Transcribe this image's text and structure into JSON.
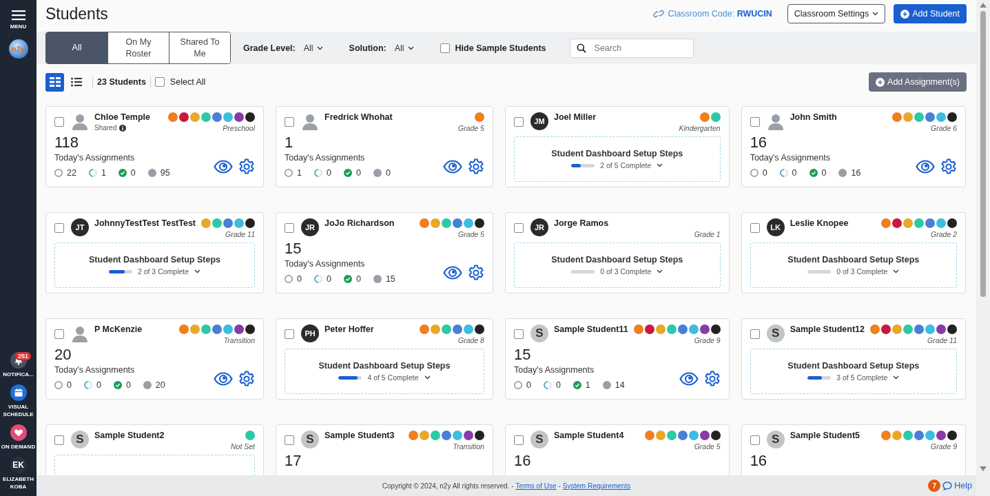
{
  "sidebar": {
    "menu_label": "MENU",
    "logo_text": "n2y",
    "items": [
      {
        "kind": "notifications",
        "label": "NOTIFICA...",
        "badge": "251"
      },
      {
        "kind": "schedule",
        "label": "VISUAL SCHEDULE"
      },
      {
        "kind": "demand",
        "label": "ON DEMAND"
      },
      {
        "kind": "user",
        "initials": "EK",
        "label": "ELIZABETH KOBA"
      }
    ]
  },
  "header": {
    "title": "Students",
    "classroom_code": "Classroom Code: **RWUCIN**",
    "settings_button": "Classroom Settings",
    "add_button": "Add Student"
  },
  "filters": {
    "tabs": [
      {
        "label": "All",
        "selected": true
      },
      {
        "label": "On My Roster",
        "selected": false
      },
      {
        "label": "Shared To Me",
        "selected": false
      }
    ],
    "dropdowns": [
      {
        "label": "Grade Level:",
        "value": "All"
      },
      {
        "label": "Solution:",
        "value": "All"
      }
    ],
    "hide_sample": {
      "label": "Hide Sample Students",
      "checked": false
    },
    "search": {
      "placeholder": "Search"
    }
  },
  "toolbar": {
    "views": [
      {
        "kind": "grid",
        "selected": true
      },
      {
        "kind": "list",
        "selected": false
      }
    ],
    "count": "23 Students",
    "select_all": {
      "label": "Select All",
      "checked": false
    },
    "add_assignments": "Add Assignment(s)"
  },
  "cards": [
    {
      "name": "Chloe Temple",
      "checked": false,
      "avatar": {
        "kind": "image"
      },
      "shared": "Shared",
      "grade": "Preschool",
      "solutions": [
        {
          "color": "#f07f1e"
        },
        {
          "color": "#c8193c"
        },
        {
          "color": "#e8a928"
        },
        {
          "color": "#2cc9a8"
        },
        {
          "color": "#4a7fd6"
        },
        {
          "color": "#3dbde0"
        },
        {
          "color": "#8a3aa8"
        },
        {
          "color": "#222222"
        }
      ],
      "kind": "assignments",
      "total": "118",
      "label": "Today's Assignments",
      "stats": [
        {
          "kind": "not_started",
          "count": "22"
        },
        {
          "kind": "in_progress",
          "count": "1"
        },
        {
          "kind": "complete",
          "count": "0"
        },
        {
          "kind": "other",
          "count": "95"
        }
      ]
    },
    {
      "name": "Fredrick Whohat",
      "checked": false,
      "avatar": {
        "kind": "image"
      },
      "grade": "Grade 5",
      "solutions": [
        {
          "color": "#f07f1e"
        }
      ],
      "kind": "assignments",
      "total": "1",
      "label": "Today's Assignments",
      "stats": [
        {
          "kind": "not_started",
          "count": "1"
        },
        {
          "kind": "in_progress",
          "count": "0"
        },
        {
          "kind": "complete",
          "count": "0"
        },
        {
          "kind": "other",
          "count": "0"
        }
      ]
    },
    {
      "name": "Joel Miller",
      "checked": false,
      "avatar": {
        "kind": "initials",
        "text": "JM"
      },
      "grade": "Kindergarten",
      "solutions": [
        {
          "color": "#f07f1e"
        },
        {
          "color": "#2cc9a8"
        }
      ],
      "kind": "setup",
      "setup_title": "Student Dashboard Setup Steps",
      "progress": "2 of 5 Complete",
      "level": 0.4
    },
    {
      "name": "John Smith",
      "checked": false,
      "avatar": {
        "kind": "image"
      },
      "grade": "Grade 6",
      "solutions": [
        {
          "color": "#f07f1e"
        },
        {
          "color": "#e8a928"
        },
        {
          "color": "#2cc9a8"
        },
        {
          "color": "#4a7fd6"
        },
        {
          "color": "#3dbde0"
        },
        {
          "color": "#222222"
        }
      ],
      "kind": "assignments",
      "total": "16",
      "label": "Today's Assignments",
      "stats": [
        {
          "kind": "not_started",
          "count": "0"
        },
        {
          "kind": "in_progress",
          "count": "0"
        },
        {
          "kind": "complete",
          "count": "0"
        },
        {
          "kind": "other",
          "count": "16"
        }
      ]
    },
    {
      "name": "JohnnyTestTest TestTest",
      "checked": false,
      "avatar": {
        "kind": "initials",
        "text": "JT"
      },
      "grade": "Grade 11",
      "solutions": [
        {
          "color": "#e8a928"
        },
        {
          "color": "#2cc9a8"
        },
        {
          "color": "#4a7fd6"
        },
        {
          "color": "#3dbde0"
        },
        {
          "color": "#222222"
        }
      ],
      "kind": "setup",
      "setup_title": "Student Dashboard Setup Steps",
      "progress": "2 of 3 Complete",
      "level": 0.67
    },
    {
      "name": "JoJo Richardson",
      "checked": false,
      "avatar": {
        "kind": "initials",
        "text": "JR"
      },
      "grade": "Grade 5",
      "solutions": [
        {
          "color": "#f07f1e"
        },
        {
          "color": "#e8a928"
        },
        {
          "color": "#2cc9a8"
        },
        {
          "color": "#4a7fd6"
        },
        {
          "color": "#3dbde0"
        },
        {
          "color": "#222222"
        }
      ],
      "kind": "assignments",
      "total": "15",
      "label": "Today's Assignments",
      "stats": [
        {
          "kind": "not_started",
          "count": "0"
        },
        {
          "kind": "in_progress",
          "count": "0"
        },
        {
          "kind": "complete",
          "count": "0"
        },
        {
          "kind": "other",
          "count": "15"
        }
      ]
    },
    {
      "name": "Jorge Ramos",
      "checked": false,
      "avatar": {
        "kind": "initials",
        "text": "JR"
      },
      "grade": "Grade 1",
      "kind": "setup",
      "setup_title": "Student Dashboard Setup Steps",
      "progress": "0 of 3 Complete",
      "level": 0
    },
    {
      "name": "Leslie Knopee",
      "checked": false,
      "avatar": {
        "kind": "initials",
        "text": "LK"
      },
      "grade": "Grade 2",
      "solutions": [
        {
          "color": "#f07f1e"
        },
        {
          "color": "#c8193c"
        },
        {
          "color": "#e8a928"
        },
        {
          "color": "#2cc9a8"
        },
        {
          "color": "#4a7fd6"
        },
        {
          "color": "#3dbde0"
        },
        {
          "color": "#222222"
        }
      ],
      "kind": "setup",
      "setup_title": "Student Dashboard Setup Steps",
      "progress": "0 of 3 Complete",
      "level": 0
    },
    {
      "name": "P McKenzie",
      "checked": false,
      "avatar": {
        "kind": "image"
      },
      "grade": "Transition",
      "solutions": [
        {
          "color": "#f07f1e"
        },
        {
          "color": "#e8a928"
        },
        {
          "color": "#2cc9a8"
        },
        {
          "color": "#4a7fd6"
        },
        {
          "color": "#3dbde0"
        },
        {
          "color": "#8a3aa8"
        },
        {
          "color": "#222222"
        }
      ],
      "kind": "assignments",
      "total": "20",
      "label": "Today's Assignments",
      "stats": [
        {
          "kind": "not_started",
          "count": "0"
        },
        {
          "kind": "in_progress",
          "count": "0"
        },
        {
          "kind": "complete",
          "count": "0"
        },
        {
          "kind": "other",
          "count": "20"
        }
      ]
    },
    {
      "name": "Peter Hoffer",
      "checked": false,
      "avatar": {
        "kind": "initials",
        "text": "PH"
      },
      "grade": "Grade 8",
      "solutions": [
        {
          "color": "#f07f1e"
        },
        {
          "color": "#e8a928"
        },
        {
          "color": "#2cc9a8"
        },
        {
          "color": "#4a7fd6"
        },
        {
          "color": "#3dbde0"
        },
        {
          "color": "#222222"
        }
      ],
      "kind": "setup",
      "setup_title": "Student Dashboard Setup Steps",
      "progress": "4 of 5 Complete",
      "level": 0.8
    },
    {
      "name": "Sample Student11",
      "checked": false,
      "avatar": {
        "kind": "sample",
        "text": "S"
      },
      "grade": "Grade 9",
      "solutions": [
        {
          "color": "#f07f1e"
        },
        {
          "color": "#c8193c"
        },
        {
          "color": "#e8a928"
        },
        {
          "color": "#2cc9a8"
        },
        {
          "color": "#4a7fd6"
        },
        {
          "color": "#3dbde0"
        },
        {
          "color": "#8a3aa8"
        },
        {
          "color": "#222222"
        }
      ],
      "kind": "assignments",
      "total": "15",
      "label": "Today's Assignments",
      "stats": [
        {
          "kind": "not_started",
          "count": "0"
        },
        {
          "kind": "in_progress",
          "count": "0"
        },
        {
          "kind": "complete",
          "count": "1"
        },
        {
          "kind": "other",
          "count": "14"
        }
      ]
    },
    {
      "name": "Sample Student12",
      "checked": false,
      "avatar": {
        "kind": "sample",
        "text": "S"
      },
      "grade": "Grade 11",
      "solutions": [
        {
          "color": "#f07f1e"
        },
        {
          "color": "#c8193c"
        },
        {
          "color": "#e8a928"
        },
        {
          "color": "#2cc9a8"
        },
        {
          "color": "#4a7fd6"
        },
        {
          "color": "#3dbde0"
        },
        {
          "color": "#8a3aa8"
        },
        {
          "color": "#222222"
        }
      ],
      "kind": "setup",
      "setup_title": "Student Dashboard Setup Steps",
      "progress": "3 of 5 Complete",
      "level": 0.6
    },
    {
      "name": "Sample Student2",
      "checked": false,
      "avatar": {
        "kind": "sample",
        "text": "S"
      },
      "grade": "Not Set",
      "solutions": [
        {
          "color": "#2cc9a8"
        }
      ],
      "kind": "setup"
    },
    {
      "name": "Sample Student3",
      "checked": false,
      "avatar": {
        "kind": "sample",
        "text": "S"
      },
      "grade": "Transition",
      "solutions": [
        {
          "color": "#f07f1e"
        },
        {
          "color": "#e8a928"
        },
        {
          "color": "#2cc9a8"
        },
        {
          "color": "#4a7fd6"
        },
        {
          "color": "#3dbde0"
        },
        {
          "color": "#8a3aa8"
        },
        {
          "color": "#222222"
        }
      ],
      "kind": "assignments",
      "total": "17"
    },
    {
      "name": "Sample Student4",
      "checked": false,
      "avatar": {
        "kind": "sample",
        "text": "S"
      },
      "grade": "Grade 5",
      "solutions": [
        {
          "color": "#f07f1e"
        },
        {
          "color": "#e8a928"
        },
        {
          "color": "#2cc9a8"
        },
        {
          "color": "#4a7fd6"
        },
        {
          "color": "#3dbde0"
        },
        {
          "color": "#8a3aa8"
        },
        {
          "color": "#222222"
        }
      ],
      "kind": "assignments",
      "total": "16"
    },
    {
      "name": "Sample Student5",
      "checked": false,
      "avatar": {
        "kind": "sample",
        "text": "S"
      },
      "grade": "Grade 9",
      "solutions": [
        {
          "color": "#f07f1e"
        },
        {
          "color": "#e8a928"
        },
        {
          "color": "#2cc9a8"
        },
        {
          "color": "#4a7fd6"
        },
        {
          "color": "#3dbde0"
        },
        {
          "color": "#8a3aa8"
        },
        {
          "color": "#222222"
        }
      ],
      "kind": "assignments",
      "total": "16"
    }
  ],
  "footer": {
    "copyright": "Copyright © 2024, n2y All rights reserved. -",
    "links": [
      "Terms of Use",
      "System Requirements"
    ],
    "separator": "-",
    "help_badge": "7",
    "help": "Help"
  }
}
